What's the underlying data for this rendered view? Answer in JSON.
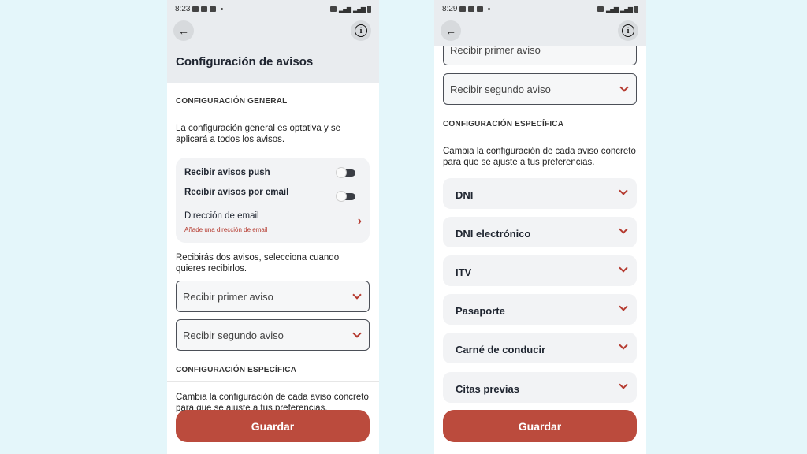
{
  "left": {
    "status": {
      "time": "8:23"
    },
    "title": "Configuración de avisos",
    "general_header": "CONFIGURACIÓN GENERAL",
    "general_desc": "La configuración general es optativa y se aplicará a todos los avisos.",
    "push_label": "Recibir avisos push",
    "email_toggle_label": "Recibir avisos por email",
    "email_address_label": "Dirección de email",
    "email_address_hint": "Añade una dirección de email",
    "two_notices_desc": "Recibirás dos avisos, selecciona cuando quieres recibirlos.",
    "first_notice": "Recibir primer aviso",
    "second_notice": "Recibir segundo aviso",
    "specific_header": "CONFIGURACIÓN ESPECÍFICA",
    "specific_desc": "Cambia la configuración de cada aviso concreto para que se ajuste a tus preferencias.",
    "save": "Guardar"
  },
  "right": {
    "status": {
      "time": "8:29"
    },
    "first_notice": "Recibir primer aviso",
    "second_notice": "Recibir segundo aviso",
    "specific_header": "CONFIGURACIÓN ESPECÍFICA",
    "specific_desc": "Cambia la configuración de cada aviso concreto para que se ajuste a tus preferencias.",
    "items": [
      {
        "label": "DNI"
      },
      {
        "label": "DNI electrónico"
      },
      {
        "label": "ITV"
      },
      {
        "label": "Pasaporte"
      },
      {
        "label": "Carné de conducir"
      },
      {
        "label": "Citas previas"
      }
    ],
    "save": "Guardar"
  },
  "colors": {
    "accent": "#bb4b3d",
    "background": "#e4f6fa",
    "header": "#e9ecef"
  },
  "icons": {
    "back": "arrow-left-icon",
    "info": "info-icon",
    "chevron": "chevron-down-icon"
  }
}
